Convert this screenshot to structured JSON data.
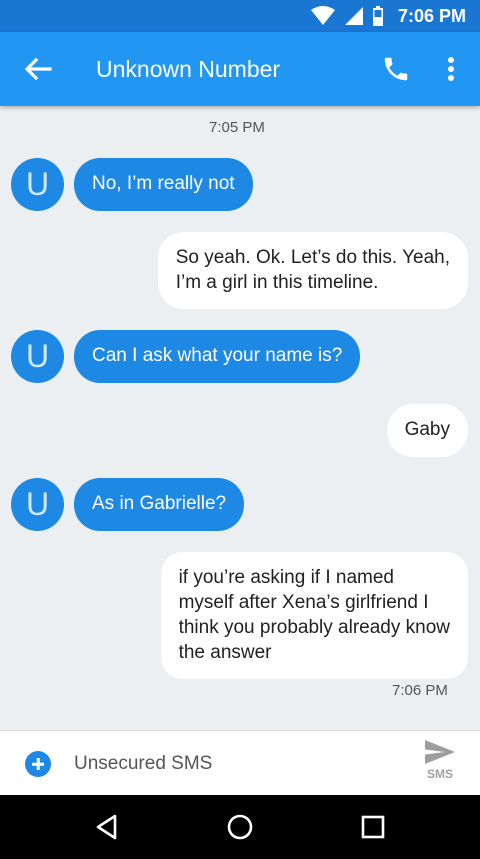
{
  "status_bar": {
    "time": "7:06 PM",
    "icons": [
      "wifi-icon",
      "cell-signal-icon",
      "battery-icon"
    ]
  },
  "app_bar": {
    "title": "Unknown Number",
    "back_icon": "arrow-back-icon",
    "call_icon": "phone-icon",
    "more_icon": "more-vert-icon"
  },
  "conversation": {
    "top_timestamp": "7:05 PM",
    "bottom_timestamp": "7:06 PM",
    "avatar_letter": "U",
    "messages": [
      {
        "direction": "incoming",
        "text": "No, I’m really not"
      },
      {
        "direction": "outgoing",
        "lines": [
          "So yeah. Ok. Let’s do this. Yeah,",
          "I’m a girl in this timeline."
        ]
      },
      {
        "direction": "incoming",
        "text": "Can I ask what your name is?"
      },
      {
        "direction": "outgoing",
        "text": "Gaby"
      },
      {
        "direction": "incoming",
        "text": "As in Gabrielle?"
      },
      {
        "direction": "outgoing",
        "lines": [
          "if you’re asking if I named",
          "myself after Xena’s girlfriend I",
          "think you probably already know",
          "the answer"
        ]
      }
    ]
  },
  "composer": {
    "placeholder": "Unsecured SMS",
    "send_label": "SMS",
    "attach_icon": "add-circle-icon",
    "send_icon": "send-icon"
  },
  "nav_bar": {
    "icons": [
      "back-triangle-icon",
      "home-circle-icon",
      "recents-square-icon"
    ]
  },
  "colors": {
    "status_bar": "#1976d2",
    "app_bar": "#2196f3",
    "incoming_bubble": "#1e88e5",
    "outgoing_bubble": "#ffffff",
    "background": "#eceff1"
  }
}
